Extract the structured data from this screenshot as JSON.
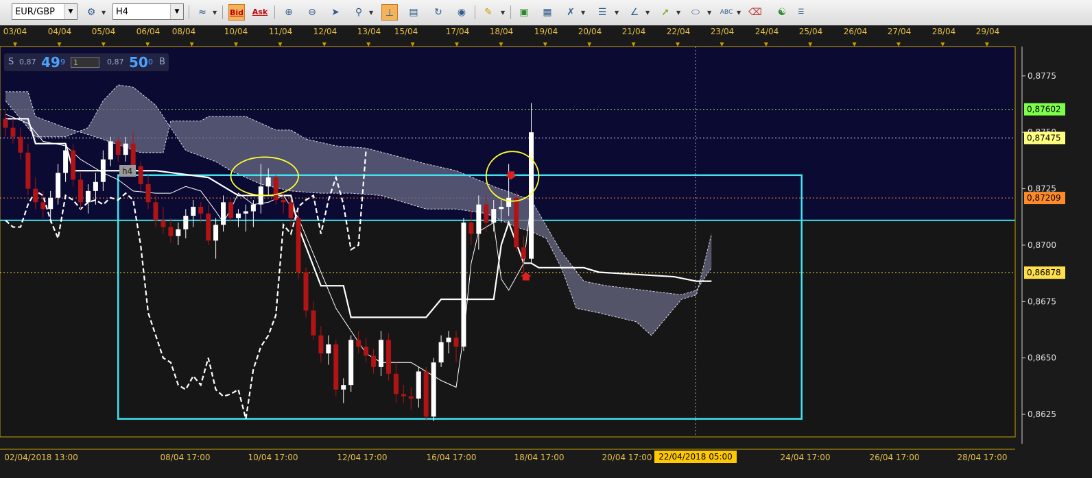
{
  "toolbar": {
    "symbol": "EUR/GBP",
    "timeframe": "H4",
    "bid_label": "Bid",
    "ask_label": "Ask",
    "buttons": [
      "new-chart-icon",
      "indicator-icon",
      "zoom-in-icon",
      "zoom-out-icon",
      "cursor-icon",
      "zoom-select-icon",
      "crosshair-icon",
      "template-icon",
      "refresh-icon",
      "globe-icon",
      "ruler-icon",
      "image-icon",
      "screenshot-icon",
      "compare-icon",
      "bars-icon",
      "fibonacci-icon",
      "trendline-icon",
      "ellipse-icon",
      "text-abc-icon",
      "eraser-icon",
      "tree-icon",
      "collapse-icon"
    ]
  },
  "price_panel": {
    "sell_label": "S",
    "sell_prefix": "0,87",
    "sell_big": "49",
    "sell_sup": "9",
    "qty": "1",
    "buy_prefix": "0,87",
    "buy_big": "50",
    "buy_sup": "0",
    "buy_label": "B"
  },
  "top_dates": [
    "03/04",
    "04/04",
    "05/04",
    "06/04",
    "08/04",
    "10/04",
    "11/04",
    "12/04",
    "13/04",
    "15/04",
    "17/04",
    "18/04",
    "19/04",
    "20/04",
    "21/04",
    "22/04",
    "23/04",
    "24/04",
    "25/04",
    "26/04",
    "27/04",
    "28/04",
    "29/04"
  ],
  "chart_data": {
    "type": "candlestick",
    "symbol": "EUR/GBP",
    "timeframe": "H4",
    "y_axis_ticks": [
      "0,8775",
      "0,8750",
      "0,8725",
      "0,8700",
      "0,8675",
      "0,8650",
      "0,8625"
    ],
    "ylim": [
      0.8615,
      0.8788
    ],
    "price_tags": [
      {
        "label": "0,87602",
        "value": 0.87602,
        "color": "#7dff4a"
      },
      {
        "label": "0,87475",
        "value": 0.87475,
        "color": "#ffff80"
      },
      {
        "label": "0,87209",
        "value": 0.87209,
        "color": "#ff8a2a"
      },
      {
        "label": "0,86878",
        "value": 0.86878,
        "color": "#ffe04a"
      }
    ],
    "bottom_labels": [
      "02/04/2018 13:00",
      "08/04 17:00",
      "10/04 17:00",
      "12/04 17:00",
      "16/04 17:00",
      "18/04 17:00",
      "20/04 17:00",
      "24/04 17:00",
      "26/04 17:00",
      "28/04 17:00"
    ],
    "crosshair_label": "22/04/2018 05:00",
    "chart_tag": "h4",
    "ohlc": [
      [
        0.8756,
        0.876,
        0.8748,
        0.8752
      ],
      [
        0.8752,
        0.8756,
        0.8745,
        0.8748
      ],
      [
        0.8748,
        0.8752,
        0.8738,
        0.8741
      ],
      [
        0.8741,
        0.8745,
        0.8722,
        0.8725
      ],
      [
        0.8725,
        0.873,
        0.8716,
        0.8719
      ],
      [
        0.8719,
        0.8724,
        0.8712,
        0.8716
      ],
      [
        0.8716,
        0.8724,
        0.871,
        0.8721
      ],
      [
        0.8721,
        0.8736,
        0.8718,
        0.8732
      ],
      [
        0.8732,
        0.8745,
        0.8728,
        0.8742
      ],
      [
        0.8742,
        0.8745,
        0.8726,
        0.8729
      ],
      [
        0.8729,
        0.8732,
        0.8716,
        0.8719
      ],
      [
        0.8719,
        0.8727,
        0.8714,
        0.8724
      ],
      [
        0.8724,
        0.8732,
        0.8718,
        0.8728
      ],
      [
        0.8728,
        0.8742,
        0.8724,
        0.8738
      ],
      [
        0.8738,
        0.8748,
        0.8735,
        0.8746
      ],
      [
        0.8746,
        0.8748,
        0.8737,
        0.874
      ],
      [
        0.874,
        0.8748,
        0.8737,
        0.8745
      ],
      [
        0.8745,
        0.875,
        0.8733,
        0.8735
      ],
      [
        0.8735,
        0.8737,
        0.8724,
        0.8727
      ],
      [
        0.8727,
        0.8731,
        0.8716,
        0.8719
      ],
      [
        0.8719,
        0.8722,
        0.8708,
        0.8711
      ],
      [
        0.8711,
        0.8717,
        0.8705,
        0.8708
      ],
      [
        0.8708,
        0.8712,
        0.8701,
        0.8704
      ],
      [
        0.8704,
        0.871,
        0.87,
        0.8707
      ],
      [
        0.8707,
        0.8716,
        0.8703,
        0.8713
      ],
      [
        0.8713,
        0.872,
        0.8708,
        0.8717
      ],
      [
        0.8717,
        0.8719,
        0.871,
        0.8714
      ],
      [
        0.8714,
        0.8718,
        0.87,
        0.8702
      ],
      [
        0.8702,
        0.8712,
        0.8694,
        0.8709
      ],
      [
        0.8709,
        0.8722,
        0.8706,
        0.8719
      ],
      [
        0.8719,
        0.8721,
        0.871,
        0.8712
      ],
      [
        0.8712,
        0.8716,
        0.8708,
        0.8714
      ],
      [
        0.8714,
        0.8718,
        0.8706,
        0.8715
      ],
      [
        0.8715,
        0.872,
        0.8708,
        0.8718
      ],
      [
        0.8718,
        0.8736,
        0.8714,
        0.8726
      ],
      [
        0.8726,
        0.8734,
        0.8722,
        0.873
      ],
      [
        0.873,
        0.8731,
        0.8718,
        0.872
      ],
      [
        0.872,
        0.8723,
        0.8714,
        0.8719
      ],
      [
        0.8719,
        0.8721,
        0.8708,
        0.8712
      ],
      [
        0.8712,
        0.8715,
        0.8685,
        0.8688
      ],
      [
        0.8688,
        0.869,
        0.8668,
        0.8671
      ],
      [
        0.8671,
        0.8675,
        0.8658,
        0.866
      ],
      [
        0.866,
        0.8664,
        0.8648,
        0.8652
      ],
      [
        0.8652,
        0.866,
        0.8647,
        0.8656
      ],
      [
        0.8656,
        0.8658,
        0.8633,
        0.8636
      ],
      [
        0.8636,
        0.8641,
        0.863,
        0.8638
      ],
      [
        0.8638,
        0.866,
        0.8635,
        0.8658
      ],
      [
        0.8658,
        0.8662,
        0.8652,
        0.8655
      ],
      [
        0.8655,
        0.8659,
        0.8648,
        0.8651
      ],
      [
        0.8651,
        0.8654,
        0.8643,
        0.8646
      ],
      [
        0.8646,
        0.8662,
        0.8642,
        0.8658
      ],
      [
        0.8658,
        0.8661,
        0.864,
        0.8643
      ],
      [
        0.8643,
        0.8648,
        0.863,
        0.8634
      ],
      [
        0.8634,
        0.8638,
        0.863,
        0.8633
      ],
      [
        0.8633,
        0.8637,
        0.8627,
        0.8632
      ],
      [
        0.8632,
        0.8646,
        0.8628,
        0.8644
      ],
      [
        0.8644,
        0.8646,
        0.8622,
        0.8624
      ],
      [
        0.8624,
        0.865,
        0.8622,
        0.8648
      ],
      [
        0.8648,
        0.866,
        0.8646,
        0.8657
      ],
      [
        0.8657,
        0.8662,
        0.8652,
        0.8659
      ],
      [
        0.8659,
        0.8662,
        0.8648,
        0.8655
      ],
      [
        0.8655,
        0.8712,
        0.8653,
        0.871
      ],
      [
        0.871,
        0.8716,
        0.87,
        0.8705
      ],
      [
        0.8705,
        0.8722,
        0.8698,
        0.8718
      ],
      [
        0.8718,
        0.8722,
        0.8706,
        0.871
      ],
      [
        0.871,
        0.872,
        0.8706,
        0.8716
      ],
      [
        0.8716,
        0.872,
        0.871,
        0.8717
      ],
      [
        0.8717,
        0.8736,
        0.8713,
        0.8721
      ],
      [
        0.8721,
        0.8724,
        0.8697,
        0.8699
      ],
      [
        0.8699,
        0.8704,
        0.8688,
        0.8694
      ],
      [
        0.8694,
        0.8763,
        0.8692,
        0.875
      ]
    ],
    "horizontal_lines": [
      {
        "value": 0.87602,
        "style": "dotted",
        "color": "#7dff4a"
      },
      {
        "value": 0.87475,
        "style": "dotted",
        "color": "#ffffff"
      },
      {
        "value": 0.87209,
        "style": "dotted",
        "color": "#ff8a2a"
      },
      {
        "value": 0.86878,
        "style": "dotted",
        "color": "#ffe04a"
      },
      {
        "value": 0.8711,
        "style": "solid",
        "color": "#3fe4f0"
      }
    ],
    "rectangle": {
      "x_from_bar": 15,
      "x_to_bar": 106,
      "top": 0.8731,
      "bottom": 0.8623,
      "color": "#3fe4f0"
    },
    "ellipses": [
      {
        "center_bar": 34.5,
        "center": 0.87305,
        "rx_bars": 4.5,
        "ry": 0.00085,
        "color": "#ffff30"
      },
      {
        "center_bar": 67.5,
        "center": 0.87305,
        "rx_bars": 3.5,
        "ry": 0.0011,
        "color": "#ffff30"
      }
    ],
    "signals": [
      {
        "bar": 67.3,
        "value": 0.8729,
        "direction": "down"
      },
      {
        "bar": 69.3,
        "value": 0.8688,
        "direction": "up"
      }
    ],
    "kijun": [
      [
        0,
        0.8756
      ],
      [
        3,
        0.8756
      ],
      [
        4,
        0.8745
      ],
      [
        8,
        0.8745
      ],
      [
        9,
        0.8733
      ],
      [
        20,
        0.8733
      ],
      [
        27,
        0.873
      ],
      [
        31,
        0.8722
      ],
      [
        38,
        0.8722
      ],
      [
        39,
        0.8708
      ],
      [
        42,
        0.8682
      ],
      [
        45,
        0.8682
      ],
      [
        46,
        0.8668
      ],
      [
        56,
        0.8668
      ],
      [
        58,
        0.8676
      ],
      [
        59,
        0.8676
      ],
      [
        62,
        0.8676
      ],
      [
        63,
        0.8676
      ],
      [
        65,
        0.8676
      ],
      [
        66,
        0.87
      ],
      [
        67,
        0.871
      ],
      [
        69,
        0.8692
      ],
      [
        70,
        0.8692
      ],
      [
        71,
        0.869
      ],
      [
        77,
        0.869
      ],
      [
        79,
        0.8688
      ],
      [
        89,
        0.8686
      ],
      [
        92,
        0.8684
      ],
      [
        94,
        0.8684
      ]
    ],
    "tenkan": [
      [
        0,
        0.8758
      ],
      [
        3,
        0.8754
      ],
      [
        5,
        0.8746
      ],
      [
        8,
        0.8744
      ],
      [
        10,
        0.8738
      ],
      [
        13,
        0.8732
      ],
      [
        15,
        0.8729
      ],
      [
        17,
        0.8724
      ],
      [
        20,
        0.8723
      ],
      [
        22,
        0.8723
      ],
      [
        24,
        0.8726
      ],
      [
        26,
        0.8724
      ],
      [
        28,
        0.8715
      ],
      [
        29,
        0.871
      ],
      [
        30,
        0.8716
      ],
      [
        31,
        0.8723
      ],
      [
        33,
        0.8718
      ],
      [
        35,
        0.8719
      ],
      [
        37,
        0.8722
      ],
      [
        39,
        0.8712
      ],
      [
        42,
        0.8688
      ],
      [
        44,
        0.8672
      ],
      [
        46,
        0.8662
      ],
      [
        48,
        0.8652
      ],
      [
        50,
        0.8648
      ],
      [
        52,
        0.8648
      ],
      [
        54,
        0.8648
      ],
      [
        56,
        0.8644
      ],
      [
        58,
        0.864
      ],
      [
        60,
        0.8637
      ],
      [
        61,
        0.866
      ],
      [
        62,
        0.8692
      ],
      [
        63,
        0.8706
      ],
      [
        65,
        0.871
      ],
      [
        66,
        0.8685
      ],
      [
        67,
        0.868
      ],
      [
        69,
        0.8692
      ],
      [
        70,
        0.872
      ]
    ],
    "chikou": [
      [
        0,
        0.8711
      ],
      [
        1,
        0.8708
      ],
      [
        2,
        0.8708
      ],
      [
        3,
        0.8718
      ],
      [
        4,
        0.8724
      ],
      [
        5,
        0.8722
      ],
      [
        6,
        0.8711
      ],
      [
        7,
        0.8703
      ],
      [
        8,
        0.8722
      ],
      [
        9,
        0.872
      ],
      [
        10,
        0.8716
      ],
      [
        11,
        0.8719
      ],
      [
        12,
        0.872
      ],
      [
        13,
        0.8718
      ],
      [
        14,
        0.8721
      ],
      [
        15,
        0.872
      ],
      [
        16,
        0.8723
      ],
      [
        17,
        0.872
      ],
      [
        18,
        0.87
      ],
      [
        19,
        0.867
      ],
      [
        20,
        0.866
      ],
      [
        21,
        0.865
      ],
      [
        22,
        0.8648
      ],
      [
        23,
        0.8638
      ],
      [
        24,
        0.8636
      ],
      [
        25,
        0.8642
      ],
      [
        26,
        0.8638
      ],
      [
        27,
        0.865
      ],
      [
        28,
        0.8636
      ],
      [
        29,
        0.8633
      ],
      [
        30,
        0.8634
      ],
      [
        31,
        0.8636
      ],
      [
        32,
        0.8623
      ],
      [
        33,
        0.8645
      ],
      [
        34,
        0.8655
      ],
      [
        35,
        0.866
      ],
      [
        36,
        0.8669
      ],
      [
        37,
        0.8709
      ],
      [
        38,
        0.8705
      ],
      [
        39,
        0.8717
      ],
      [
        40,
        0.872
      ],
      [
        41,
        0.8722
      ],
      [
        42,
        0.8705
      ],
      [
        43,
        0.872
      ],
      [
        44,
        0.873
      ],
      [
        45,
        0.8718
      ],
      [
        46,
        0.8698
      ],
      [
        47,
        0.87
      ],
      [
        48,
        0.8742
      ]
    ],
    "span_a": [
      [
        0,
        0.8768
      ],
      [
        3,
        0.8768
      ],
      [
        4,
        0.8757
      ],
      [
        8,
        0.8752
      ],
      [
        12,
        0.8748
      ],
      [
        18,
        0.8741
      ],
      [
        21,
        0.8741
      ],
      [
        22,
        0.8755
      ],
      [
        26,
        0.8755
      ],
      [
        27,
        0.8757
      ],
      [
        32,
        0.8757
      ],
      [
        34,
        0.8754
      ],
      [
        36,
        0.8751
      ],
      [
        38,
        0.8751
      ],
      [
        40,
        0.8747
      ],
      [
        44,
        0.8744
      ],
      [
        48,
        0.8743
      ],
      [
        56,
        0.8736
      ],
      [
        60,
        0.8733
      ],
      [
        65,
        0.8726
      ],
      [
        70,
        0.872
      ],
      [
        74,
        0.8697
      ],
      [
        77,
        0.8684
      ],
      [
        80,
        0.8682
      ],
      [
        85,
        0.868
      ],
      [
        90,
        0.8678
      ],
      [
        92,
        0.868
      ],
      [
        94,
        0.869
      ]
    ],
    "span_b": [
      [
        0,
        0.8764
      ],
      [
        4,
        0.8748
      ],
      [
        8,
        0.8748
      ],
      [
        11,
        0.8752
      ],
      [
        13,
        0.8764
      ],
      [
        15,
        0.8771
      ],
      [
        17,
        0.877
      ],
      [
        20,
        0.8762
      ],
      [
        24,
        0.8742
      ],
      [
        28,
        0.8737
      ],
      [
        30,
        0.8733
      ],
      [
        34,
        0.8727
      ],
      [
        38,
        0.8724
      ],
      [
        42,
        0.8723
      ],
      [
        46,
        0.8723
      ],
      [
        50,
        0.8722
      ],
      [
        54,
        0.8718
      ],
      [
        56,
        0.8716
      ],
      [
        60,
        0.8716
      ],
      [
        64,
        0.8714
      ],
      [
        68,
        0.8708
      ],
      [
        70,
        0.8706
      ],
      [
        72,
        0.8703
      ],
      [
        74,
        0.869
      ],
      [
        76,
        0.8672
      ],
      [
        79,
        0.867
      ],
      [
        84,
        0.8666
      ],
      [
        86,
        0.866
      ],
      [
        87,
        0.8664
      ],
      [
        90,
        0.8676
      ],
      [
        92,
        0.8678
      ],
      [
        94,
        0.8705
      ]
    ]
  }
}
